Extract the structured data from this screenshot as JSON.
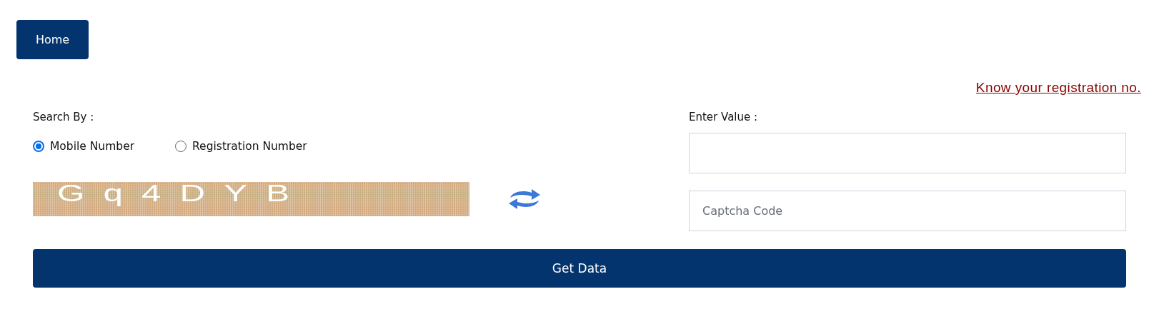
{
  "nav": {
    "home_button": "Home"
  },
  "link": "Know your registration no.",
  "search_by": {
    "label": "Search By :",
    "options": [
      {
        "label": "Mobile Number",
        "selected": true
      },
      {
        "label": "Registration Number",
        "selected": false
      }
    ]
  },
  "value_field": {
    "label": "Enter Value :"
  },
  "captcha": {
    "text": "Gq4DYB"
  },
  "captcha_field": {
    "placeholder": "Captcha Code"
  },
  "submit_button": "Get Data"
}
